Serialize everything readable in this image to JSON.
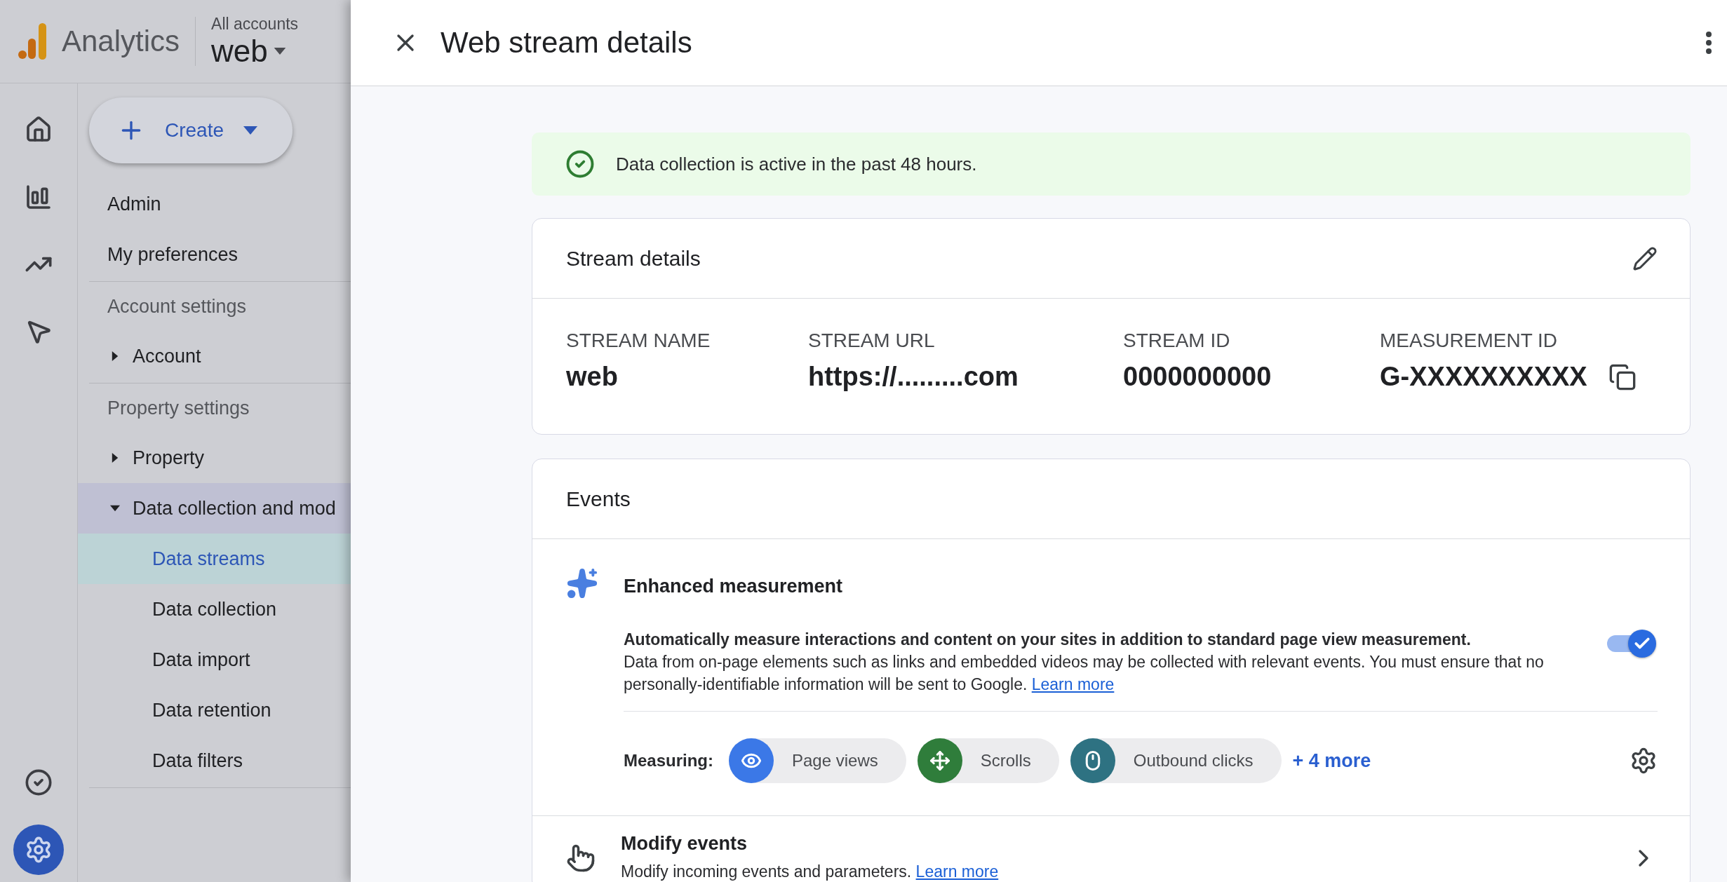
{
  "app": {
    "name": "Analytics",
    "account_path": "All accounts",
    "property": "web"
  },
  "rail": {
    "top": [
      {
        "kind": "home",
        "selected": false
      },
      {
        "kind": "reports",
        "selected": false
      },
      {
        "kind": "explore",
        "selected": false
      },
      {
        "kind": "advertising",
        "selected": false
      }
    ],
    "bottom": [
      {
        "kind": "check",
        "selected": false
      },
      {
        "kind": "admin",
        "selected": true
      }
    ]
  },
  "create_button": "Create",
  "nav": [
    {
      "items": [
        {
          "label": "Admin"
        },
        {
          "label": "My preferences"
        }
      ]
    },
    {
      "heading": "Account settings",
      "items": [
        {
          "label": "Account",
          "expanded": false
        }
      ]
    },
    {
      "heading": "Property settings",
      "items": [
        {
          "label": "Property",
          "expanded": false
        },
        {
          "label": "Data collection and mod",
          "expanded": true,
          "children": [
            {
              "label": "Data streams",
              "selected": true
            },
            {
              "label": "Data collection",
              "selected": false
            },
            {
              "label": "Data import",
              "selected": false
            },
            {
              "label": "Data retention",
              "selected": false
            },
            {
              "label": "Data filters",
              "selected": false
            }
          ]
        }
      ]
    }
  ],
  "panel": {
    "title": "Web stream details",
    "status": "Data collection is active in the past 48 hours.",
    "stream_details": {
      "title": "Stream details",
      "fields": [
        {
          "label": "STREAM NAME",
          "value": "web"
        },
        {
          "label": "STREAM URL",
          "value": "https://.........com"
        },
        {
          "label": "STREAM ID",
          "value": "0000000000"
        },
        {
          "label": "MEASUREMENT ID",
          "value": "G-XXXXXXXXXX"
        }
      ]
    },
    "events": {
      "title": "Events",
      "enhanced": {
        "title": "Enhanced measurement",
        "summary": "Automatically measure interactions and content on your sites in addition to standard page view measurement.",
        "description": "Data from on-page elements such as links and embedded videos may be collected with relevant events. You must ensure that no personally-identifiable information will be sent to Google.",
        "link": "Learn more",
        "on": true,
        "measuring_label": "Measuring:",
        "chips": [
          {
            "kind": "eye",
            "label": "Page views",
            "color": "#3b78e7"
          },
          {
            "kind": "scroll",
            "label": "Scrolls",
            "color": "#2f7d3b"
          },
          {
            "kind": "mouse",
            "label": "Outbound clicks",
            "color": "#2e7282"
          }
        ],
        "more": "+ 4 more"
      },
      "modify": {
        "title": "Modify events",
        "description": "Modify incoming events and parameters.",
        "link": "Learn more"
      }
    }
  }
}
